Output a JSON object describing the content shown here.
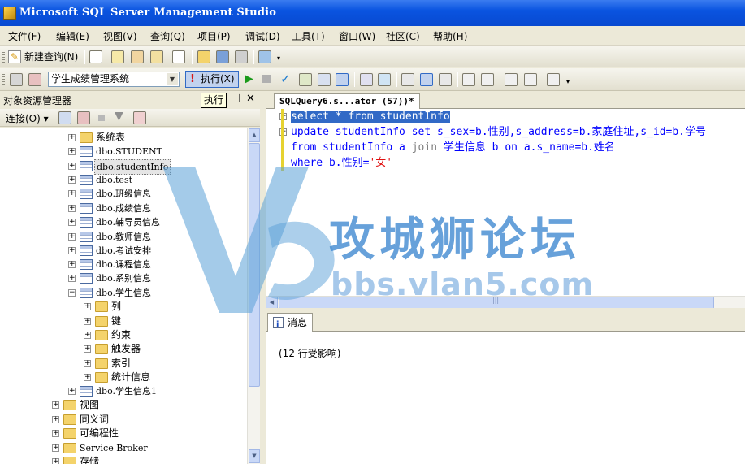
{
  "window": {
    "title": "Microsoft SQL Server Management Studio"
  },
  "menu": [
    "文件(F)",
    "编辑(E)",
    "视图(V)",
    "查询(Q)",
    "项目(P)",
    "调试(D)",
    "工具(T)",
    "窗口(W)",
    "社区(C)",
    "帮助(H)"
  ],
  "toolbar": {
    "new_query": "新建查询(N)",
    "database": "学生成绩管理系统",
    "execute": "执行(X)",
    "tooltip": "执行"
  },
  "object_explorer": {
    "title": "对象资源管理器",
    "connect": "连接(O) ▾",
    "nodes": [
      {
        "label": "系统表",
        "type": "folder",
        "expander": "+"
      },
      {
        "label": "dbo.STUDENT",
        "type": "table",
        "expander": "+"
      },
      {
        "label": "dbo.studentInfo",
        "type": "table",
        "expander": "+",
        "selected": true
      },
      {
        "label": "dbo.test",
        "type": "table",
        "expander": "+"
      },
      {
        "label": "dbo.班级信息",
        "type": "table",
        "expander": "+"
      },
      {
        "label": "dbo.成绩信息",
        "type": "table",
        "expander": "+"
      },
      {
        "label": "dbo.辅导员信息",
        "type": "table",
        "expander": "+"
      },
      {
        "label": "dbo.教师信息",
        "type": "table",
        "expander": "+"
      },
      {
        "label": "dbo.考试安排",
        "type": "table",
        "expander": "+"
      },
      {
        "label": "dbo.课程信息",
        "type": "table",
        "expander": "+"
      },
      {
        "label": "dbo.系别信息",
        "type": "table",
        "expander": "+"
      },
      {
        "label": "dbo.学生信息",
        "type": "table",
        "expander": "−"
      },
      {
        "label": "列",
        "type": "folder",
        "expander": "+"
      },
      {
        "label": "键",
        "type": "folder",
        "expander": "+"
      },
      {
        "label": "约束",
        "type": "folder",
        "expander": "+"
      },
      {
        "label": "触发器",
        "type": "folder",
        "expander": "+"
      },
      {
        "label": "索引",
        "type": "folder",
        "expander": "+"
      },
      {
        "label": "统计信息",
        "type": "folder",
        "expander": "+"
      },
      {
        "label": "dbo.学生信息1",
        "type": "table",
        "expander": "+"
      },
      {
        "label": "视图",
        "type": "folder",
        "expander": "+"
      },
      {
        "label": "同义词",
        "type": "folder",
        "expander": "+"
      },
      {
        "label": "可编程性",
        "type": "folder",
        "expander": "+"
      },
      {
        "label": "Service Broker",
        "type": "folder",
        "expander": "+"
      },
      {
        "label": "存储",
        "type": "folder",
        "expander": "+"
      }
    ]
  },
  "editor": {
    "tab": "SQLQuery6.s...ator (57))*",
    "lines": {
      "l1": "select * from studentInfo",
      "l2_kw1": "update",
      "l2_a": " studentInfo ",
      "l2_kw2": "set",
      "l2_b": " s_sex=b.性别,s_address=b.家庭住址,s_id=b.学号",
      "l3_kw1": "from",
      "l3_a": " studentInfo a ",
      "l3_join": "join",
      "l3_b": " 学生信息 b ",
      "l3_kw2": "on",
      "l3_c": " a.s_name=b.姓名",
      "l4_kw": "where",
      "l4_a": " b.性别=",
      "l4_str": "'女'"
    }
  },
  "results": {
    "tab": "消息",
    "message": "(12 行受影响)"
  },
  "watermark": {
    "text": "攻城狮论坛",
    "url": "bbs.vlan5.com"
  },
  "colors": {
    "titlebar": "#0a54e0",
    "keyword": "#0000ff",
    "string": "#e01010",
    "selection": "#3169c6"
  }
}
